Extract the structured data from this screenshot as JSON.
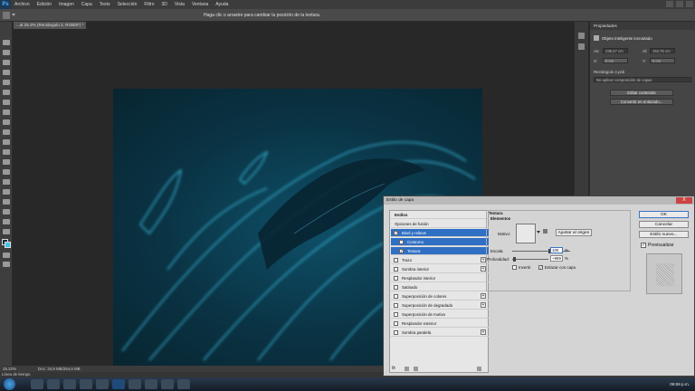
{
  "menubar": {
    "logo": "Ps",
    "items": [
      "Archivo",
      "Edición",
      "Imagen",
      "Capa",
      "Texto",
      "Selección",
      "Filtro",
      "3D",
      "Vista",
      "Ventana",
      "Ayuda"
    ]
  },
  "optbar": {
    "hint": "Haga clic o arrastre para cambiar la posición de la textura."
  },
  "doc_tab": {
    "label": "...al 25.2% (Rectángulo 2, RGB/8*) *"
  },
  "panel": {
    "tab": "Propiedades",
    "object_label": "Objeto inteligente incrustado",
    "an_label": "An:",
    "an_value": "236,27 cm",
    "al_label": "Al:",
    "al_value": "152,75 cm",
    "x_label": "X:",
    "x_value": "0 cm",
    "y_label": "Y:",
    "y_value": "0 cm",
    "file": "Rectángulo 2.psb",
    "comp": "No aplicar composición de capas",
    "edit_btn": "Editar contenido",
    "convert_btn": "Convertir en enlazado..."
  },
  "status": {
    "zoom": "25.22%",
    "doc": "Doc: 34,9 MB/254,6 MB"
  },
  "timeline": {
    "label": "Línea de tiempo"
  },
  "taskbar": {
    "clock": "06:59 p.m."
  },
  "dialog": {
    "title": "Estilo de capa",
    "close": "X",
    "styles_header": "Estilos",
    "blend_options": "Opciones de fusión",
    "items": [
      {
        "label": "Bisel y relieve",
        "checked": true,
        "selected": true,
        "sub": false,
        "plus": false
      },
      {
        "label": "Contorno",
        "checked": false,
        "selected": true,
        "sub": true,
        "plus": false
      },
      {
        "label": "Textura",
        "checked": true,
        "selected": true,
        "sub": true,
        "plus": false
      },
      {
        "label": "Trazo",
        "checked": false,
        "selected": false,
        "sub": false,
        "plus": true
      },
      {
        "label": "Sombra interior",
        "checked": false,
        "selected": false,
        "sub": false,
        "plus": true
      },
      {
        "label": "Resplandor interior",
        "checked": false,
        "selected": false,
        "sub": false,
        "plus": false
      },
      {
        "label": "Satinado",
        "checked": false,
        "selected": false,
        "sub": false,
        "plus": false
      },
      {
        "label": "Superposición de colores",
        "checked": false,
        "selected": false,
        "sub": false,
        "plus": true
      },
      {
        "label": "Superposición de degradado",
        "checked": false,
        "selected": false,
        "sub": false,
        "plus": true
      },
      {
        "label": "Superposición de motivo",
        "checked": false,
        "selected": false,
        "sub": false,
        "plus": false
      },
      {
        "label": "Resplandor exterior",
        "checked": false,
        "selected": false,
        "sub": false,
        "plus": false
      },
      {
        "label": "Sombra paralela",
        "checked": false,
        "selected": false,
        "sub": false,
        "plus": true
      }
    ],
    "fx": "fx",
    "texture_title": "Textura",
    "elements_title": "Elementos",
    "pattern_label": "Motivo:",
    "snap_btn": "Ajustar al origen",
    "scale_label": "Escala:",
    "scale_value": "100",
    "depth_label": "Profundidad:",
    "depth_value": "+999",
    "percent": "%",
    "invert_label": "Invertir",
    "link_label": "Enlazar con capa",
    "ok": "OK",
    "cancel": "Cancelar",
    "new_style": "Estilo nuevo...",
    "preview": "Previsualizar"
  },
  "colors": {
    "selection": "#2f6fc4",
    "artwork_glow": "#3fc6e8"
  }
}
